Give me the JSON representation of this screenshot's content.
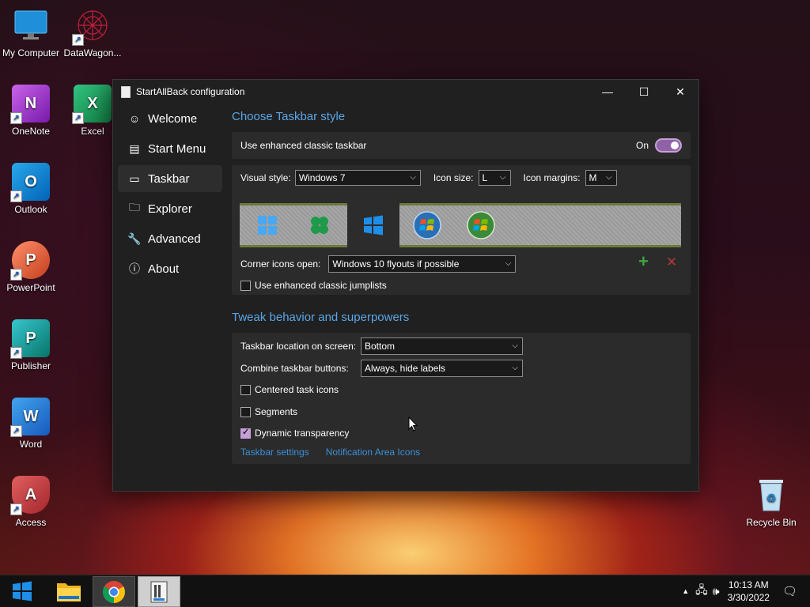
{
  "desktop": {
    "icons": [
      {
        "label": "My Computer"
      },
      {
        "label": "DataWagon..."
      },
      {
        "label": "OneNote"
      },
      {
        "label": "Excel"
      },
      {
        "label": "Outlook"
      },
      {
        "label": "PowerPoint"
      },
      {
        "label": "Publisher"
      },
      {
        "label": "Word"
      },
      {
        "label": "Access"
      },
      {
        "label": "Recycle Bin"
      }
    ]
  },
  "window": {
    "title": "StartAllBack configuration",
    "minimize": "—",
    "maximize": "☐",
    "close": "✕"
  },
  "sidebar": {
    "items": [
      {
        "label": "Welcome",
        "icon": "smile-icon"
      },
      {
        "label": "Start Menu",
        "icon": "start-menu-icon"
      },
      {
        "label": "Taskbar",
        "icon": "taskbar-icon",
        "active": true
      },
      {
        "label": "Explorer",
        "icon": "folder-icon"
      },
      {
        "label": "Advanced",
        "icon": "wrench-icon"
      },
      {
        "label": "About",
        "icon": "info-icon"
      }
    ]
  },
  "taskbar_style": {
    "section_title": "Choose Taskbar style",
    "enhanced_label": "Use enhanced classic taskbar",
    "toggle_label": "On",
    "visual_style_label": "Visual style:",
    "visual_style_value": "Windows 7",
    "icon_size_label": "Icon size:",
    "icon_size_value": "L",
    "icon_margins_label": "Icon margins:",
    "icon_margins_value": "M",
    "corner_icons_label": "Corner icons open:",
    "corner_icons_value": "Windows 10 flyouts if possible",
    "jumplists_label": "Use enhanced classic jumplists",
    "add_symbol": "+",
    "remove_symbol": "✕"
  },
  "tweak": {
    "section_title": "Tweak behavior and superpowers",
    "location_label": "Taskbar location on screen:",
    "location_value": "Bottom",
    "combine_label": "Combine taskbar buttons:",
    "combine_value": "Always, hide labels",
    "centered_label": "Centered task icons",
    "segments_label": "Segments",
    "dynamic_label": "Dynamic transparency",
    "link_taskbar": "Taskbar settings",
    "link_notification": "Notification Area Icons"
  },
  "tray": {
    "time": "10:13 AM",
    "date": "3/30/2022"
  },
  "colors": {
    "accent": "#c8a0d8",
    "link": "#3b8fd6",
    "section_title": "#5aa6e6",
    "add_green": "#3fa43f",
    "remove_red": "#b03a3a"
  }
}
